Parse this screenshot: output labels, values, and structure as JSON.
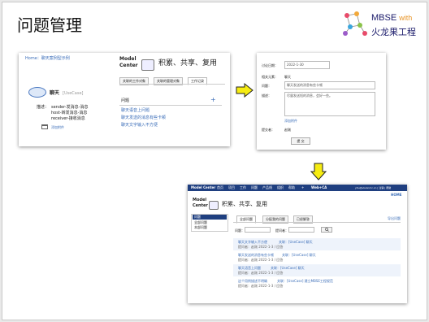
{
  "slide": {
    "title": "问题管理"
  },
  "logo": {
    "title": "MBSE",
    "with": "with",
    "subtitle": "火龙果工程"
  },
  "shot1": {
    "breadcrumb": "Home：聊天案例型示例",
    "mc": "Model\nCenter",
    "slogan": "积累、共享、复用",
    "tabs": [
      "关联的工作对象",
      "关联的管理对象",
      "工作记录"
    ],
    "element_name": "聊天",
    "element_tag": "[UseCase]",
    "desc_label": "描述：",
    "desc_lines": [
      "sender-发消息-消息",
      "host-转发消息-消息",
      "receiver-接收消息"
    ],
    "attach_label": "添加附件",
    "issues_header": "问题",
    "add_symbol": "+",
    "issues": [
      "聊天语音上问题",
      "聊天发送的消息有些卡顿",
      "聊天文字输入不方便"
    ]
  },
  "shot2": {
    "labels": [
      "讨论日期：",
      "相关元素：",
      "问题：",
      "描述：",
      "提交者："
    ],
    "date": "2022-1-30",
    "element": "聊天",
    "question": "聊天发送的消息有些卡顿",
    "description": "尽量发送短的消息，会好一些。",
    "attach": "添加附件",
    "submitter": "赵刚",
    "submit": "提 交"
  },
  "shot3": {
    "brand": "Model Center",
    "nav": [
      "首页",
      "项目",
      "工作",
      "问题",
      "产品线",
      "组织",
      "帮助"
    ],
    "nav_add": "+",
    "web_ca": "Web+CA",
    "user": "yhu@visionmc.cn | 注销 | 帮助",
    "home": "HOME",
    "mc": "Model\nCenter",
    "slogan": "积累、共享、复用",
    "side": [
      "问题",
      "全部问题",
      "本部问题"
    ],
    "tabs": [
      "全部问题",
      "分配我的问题",
      "已经解答"
    ],
    "export": "导出问题",
    "filter_q": "问题：",
    "filter_p": "提问者：",
    "items": [
      {
        "title": "聊天文字输入不方便",
        "rel": "关联：[UseCase] 聊天",
        "meta": "提问者：赵刚 2022-1-3 / 回答"
      },
      {
        "title": "聊天发送的消息有些卡顿",
        "rel": "关联：[UseCase] 聊天",
        "meta": "提问者：赵刚 2022-1-3 / 回答"
      },
      {
        "title": "聊天语音上问题",
        "rel": "关联：[UseCase] 聊天",
        "meta": "提问者：赵刚 2022-1-3 / 回答"
      },
      {
        "title": "这个用例描述不明确",
        "rel": "关联：[UseCase] 建立MBSE工程规范",
        "meta": "提问者：赵刚 2022-1-3 / 回答"
      }
    ]
  },
  "colors": {
    "arrow_fill": "#f6ec12",
    "nav": "#1f3f80",
    "link": "#3a6db8"
  }
}
